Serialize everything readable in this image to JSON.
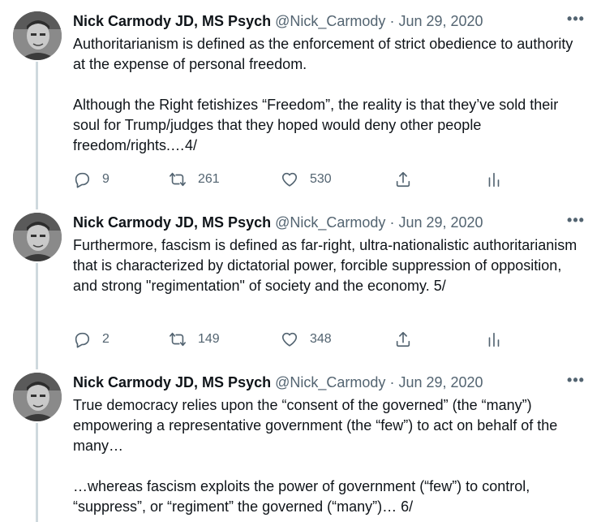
{
  "tweets": [
    {
      "name": "Nick Carmody JD, MS Psych",
      "handle": "@Nick_Carmody",
      "sep": "·",
      "date": "Jun 29, 2020",
      "more": "•••",
      "body": "Authoritarianism is defined as the enforcement of strict obedience to authority at the expense of personal freedom.\n\nAlthough the Right fetishizes “Freedom”, the reality is that they’ve sold their soul for Trump/judges that they hoped would deny other people freedom/rights.…4/",
      "replies": "9",
      "retweets": "261",
      "likes": "530"
    },
    {
      "name": "Nick Carmody JD, MS Psych",
      "handle": "@Nick_Carmody",
      "sep": "·",
      "date": "Jun 29, 2020",
      "more": "•••",
      "body": "Furthermore, fascism is defined as far-right, ultra-nationalistic authoritarianism that is characterized by dictatorial power, forcible suppression of opposition, and strong \"regimentation\" of society and the economy. 5/",
      "replies": "2",
      "retweets": "149",
      "likes": "348"
    },
    {
      "name": "Nick Carmody JD, MS Psych",
      "handle": "@Nick_Carmody",
      "sep": "·",
      "date": "Jun 29, 2020",
      "more": "•••",
      "body": "True democracy relies upon the “consent of the governed” (the “many”) empowering a representative government (the “few”) to act on behalf of the many…\n\n…whereas fascism exploits the power of government (“few”) to control, “suppress”, or “regiment” the governed (“many”)… 6/"
    }
  ]
}
